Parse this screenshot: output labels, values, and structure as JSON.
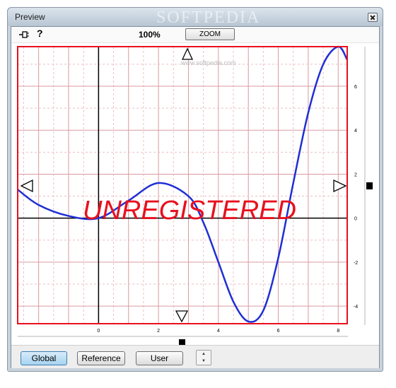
{
  "window": {
    "title": "Preview",
    "watermark": "SOFTPEDIA",
    "watermark_small": "www.softpedia.com"
  },
  "toolbar": {
    "zoom_level": "100%",
    "zoom_button": "ZOOM"
  },
  "plot": {
    "overlay_text": "UNREGISTERED",
    "colors": {
      "frame": "#e8101e",
      "curve": "#1f2fd4",
      "overlay": "#e8101e",
      "grid_major": "#d99aa0",
      "grid_minor": "#eebfc3",
      "axis": "#000000"
    },
    "x_ticks": [
      "0",
      "2",
      "4",
      "6",
      "8"
    ],
    "y_ticks": [
      "6",
      "4",
      "2",
      "0",
      "-2",
      "-4"
    ]
  },
  "chart_data": {
    "type": "line",
    "xlim": [
      -2.7,
      8.3
    ],
    "ylim": [
      -4.8,
      7.8
    ],
    "x_ticks": [
      0,
      2,
      4,
      6,
      8
    ],
    "y_ticks": [
      6,
      4,
      2,
      0,
      -2,
      -4
    ],
    "grid": true,
    "series": [
      {
        "x": [
          -2.7,
          -2,
          -1,
          0,
          1,
          2,
          3,
          3.5,
          4,
          4.5,
          5,
          5.5,
          6,
          6.5,
          7,
          7.5,
          8,
          8.3
        ],
        "y": [
          1.3,
          0.6,
          0.1,
          0.0,
          0.8,
          1.6,
          1.0,
          -0.2,
          -2.0,
          -3.8,
          -4.7,
          -4.2,
          -1.8,
          1.6,
          4.8,
          7.0,
          7.8,
          7.2
        ]
      }
    ]
  },
  "bottombar": {
    "global_label": "Global",
    "reference_label": "Reference",
    "user_label": "User",
    "spin_up": "▲",
    "spin_down": "▼"
  }
}
